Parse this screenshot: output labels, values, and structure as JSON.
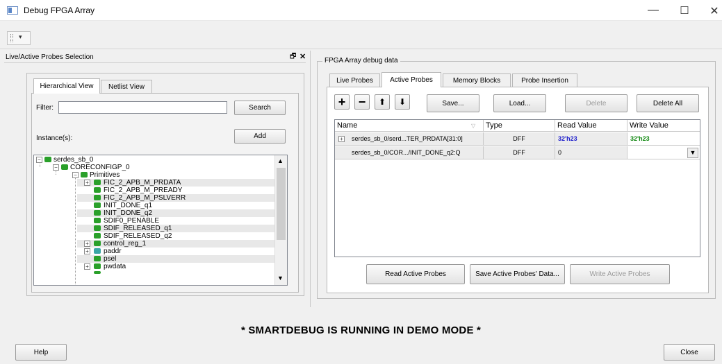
{
  "window": {
    "title": "Debug FPGA Array",
    "minimize": "—",
    "maximize": "☐",
    "close": "✕"
  },
  "toolbar": {
    "dropdown_glyph": "▾"
  },
  "left_panel": {
    "title": "Live/Active Probes Selection",
    "float_glyph": "🗗",
    "close_glyph": "✕",
    "tabs": [
      "Hierarchical View",
      "Netlist View"
    ],
    "filter_label": "Filter:",
    "filter_value": "",
    "search_button": "Search",
    "instances_label": "Instance(s):",
    "add_button": "Add",
    "tree": [
      {
        "label": "serdes_sb_0",
        "icon": "green-chip"
      },
      {
        "label": "CORECONFIGP_0",
        "icon": "green-chip"
      },
      {
        "label": "Primitives",
        "icon": "green-chip"
      },
      {
        "label": "FIC_2_APB_M_PRDATA",
        "icon": "green-chip"
      },
      {
        "label": "FIC_2_APB_M_PREADY",
        "icon": "green-chip"
      },
      {
        "label": "FIC_2_APB_M_PSLVERR",
        "icon": "green-chip"
      },
      {
        "label": "INIT_DONE_q1",
        "icon": "green-chip"
      },
      {
        "label": "INIT_DONE_q2",
        "icon": "green-chip"
      },
      {
        "label": "SDIF0_PENABLE",
        "icon": "green-chip"
      },
      {
        "label": "SDIF_RELEASED_q1",
        "icon": "green-chip"
      },
      {
        "label": "SDIF_RELEASED_q2",
        "icon": "green-chip"
      },
      {
        "label": "control_reg_1",
        "icon": "green-chip"
      },
      {
        "label": "paddr",
        "icon": "teal-chip"
      },
      {
        "label": "psel",
        "icon": "green-chip"
      },
      {
        "label": "pwdata",
        "icon": "green-chip"
      }
    ]
  },
  "right_panel": {
    "group_title": "FPGA Array debug data",
    "tabs": [
      "Live Probes",
      "Active Probes",
      "Memory Blocks",
      "Probe Insertion"
    ],
    "toolbar": {
      "add_glyph": "+",
      "remove_glyph": "−",
      "up_glyph": "⬆",
      "down_glyph": "⬇",
      "save": "Save...",
      "load": "Load...",
      "delete": "Delete",
      "delete_all": "Delete All"
    },
    "table": {
      "columns": [
        "Name",
        "Type",
        "Read Value",
        "Write Value"
      ],
      "rows": [
        {
          "expand": "+",
          "name": "serdes_sb_0/serd...TER_PRDATA[31:0]",
          "type": "DFF",
          "read": "32'h23",
          "write": "32'h23"
        },
        {
          "expand": "",
          "name": "serdes_sb_0/COR.../INIT_DONE_q2:Q",
          "type": "DFF",
          "read": "0",
          "write": ""
        }
      ]
    },
    "read_button": "Read Active Probes",
    "save_data_button": "Save Active Probes' Data...",
    "write_button": "Write Active Probes"
  },
  "demo_banner": "* SMARTDEBUG IS RUNNING IN DEMO MODE *",
  "help_button": "Help",
  "close_button": "Close",
  "colors": {
    "read_value": "#2222cc",
    "write_value": "#118811",
    "chip_green": "#2aa02a",
    "chip_teal": "#3aa6a6"
  }
}
